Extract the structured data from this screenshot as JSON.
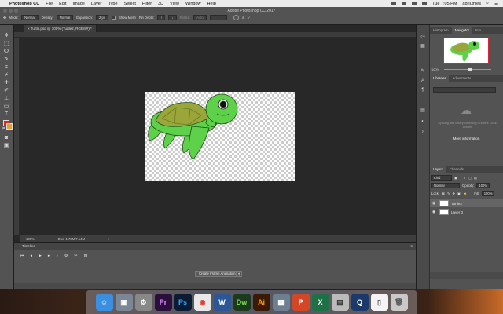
{
  "menubar": {
    "app_name": "Photoshop CC",
    "items": [
      "File",
      "Edit",
      "Image",
      "Layer",
      "Type",
      "Select",
      "Filter",
      "3D",
      "View",
      "Window",
      "Help"
    ],
    "clock": "Tue 7:05 PM",
    "user": "april.thies"
  },
  "window_title": "Adobe Photoshop CC 2017",
  "options": {
    "mode_label": "Mode:",
    "mode_value": "Normal",
    "density_label": "Density:",
    "density_value": "Normal",
    "expansion_label": "Expansion:",
    "expansion_value": "2 px",
    "show_mesh_label": "Show Mesh",
    "pin_depth_label": "Pin Depth:",
    "rotate_label": "Rotate:",
    "rotate_value": "Auto"
  },
  "document": {
    "tab_title": "Turtle.psd @ 100% (Turtle2, RGB/8#) *",
    "zoom": "100%",
    "doc_info": "Doc: 1.73M/7.14M"
  },
  "timeline": {
    "title": "Timeline",
    "create_button": "Create Frame Animation"
  },
  "navigator": {
    "tabs": [
      "Histogram",
      "Navigator",
      "Info"
    ],
    "active_tab": "Navigator",
    "zoom": "100%"
  },
  "libraries": {
    "tabs": [
      "Libraries",
      "Adjustments"
    ],
    "active_tab": "Libraries",
    "message": "Syncing and library collecting Creative Cloud content",
    "more_info": "More information"
  },
  "layers": {
    "tabs": [
      "Layers",
      "Channels"
    ],
    "active_tab": "Layers",
    "filter_kind": "Kind",
    "blend_mode": "Normal",
    "opacity_label": "Opacity:",
    "opacity_value": "100%",
    "lock_label": "Lock:",
    "fill_label": "Fill:",
    "fill_value": "100%",
    "items": [
      {
        "name": "Turtle2",
        "selected": true
      },
      {
        "name": "Layer 0",
        "selected": false
      }
    ]
  },
  "colors": {
    "foreground": "#e52222",
    "background": "#e3a331",
    "turtle_body": "#5dd14a",
    "turtle_shell": "#9aa63a"
  },
  "dock": {
    "icons": [
      "finder-icon",
      "image-capture-icon",
      "system-preferences-icon",
      "premiere-icon",
      "photoshop-icon",
      "chrome-icon",
      "word-icon",
      "dreamweaver-icon",
      "illustrator-icon",
      "preview-icon",
      "powerpoint-icon",
      "excel-icon",
      "file-icon",
      "quicktime-icon",
      "document-icon",
      "trash-icon"
    ]
  }
}
